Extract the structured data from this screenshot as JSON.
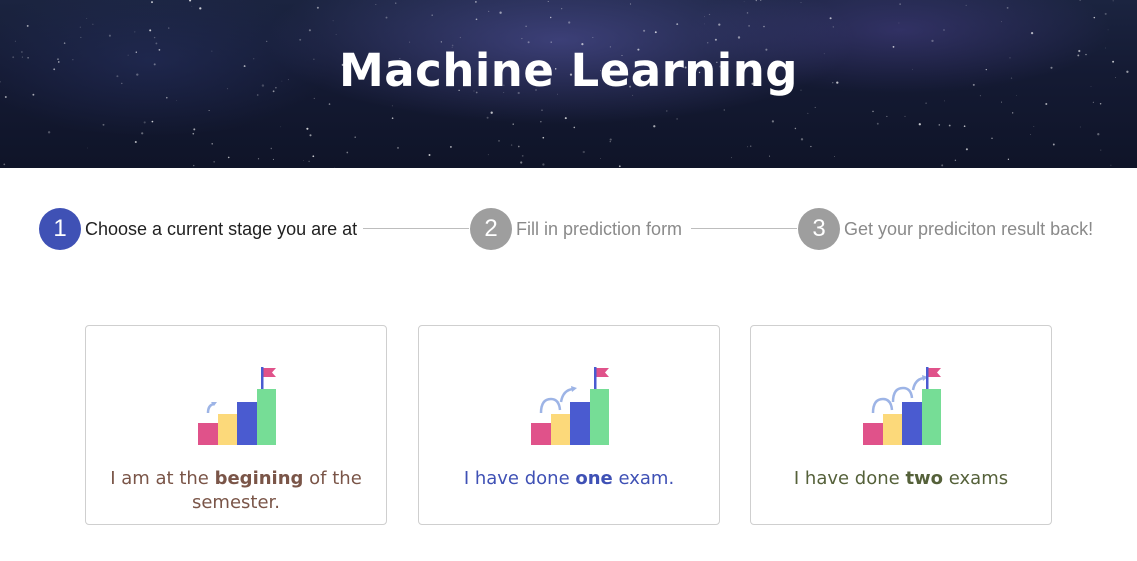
{
  "header": {
    "title": "Machine Learning"
  },
  "stepper": {
    "steps": [
      {
        "number": "1",
        "label": "Choose a current stage you are at",
        "state": "active"
      },
      {
        "number": "2",
        "label": "Fill in prediction form",
        "state": "inactive"
      },
      {
        "number": "3",
        "label": "Get your prediciton result back!",
        "state": "inactive"
      }
    ],
    "colors": {
      "active": "#3f51b5",
      "inactive": "#9e9e9e"
    }
  },
  "options": [
    {
      "text_before": "I am at the ",
      "emphasis": "begining",
      "text_after": " of the semester.",
      "color": "#7a5548",
      "icon": "bar-chart-flag-icon"
    },
    {
      "text_before": "I have done ",
      "emphasis": "one",
      "text_after": " exam.",
      "color": "#3f51b5",
      "icon": "bar-chart-flag-icon"
    },
    {
      "text_before": "I have done ",
      "emphasis": "two",
      "text_after": " exams",
      "color": "#55613a",
      "icon": "bar-chart-flag-icon"
    }
  ]
}
